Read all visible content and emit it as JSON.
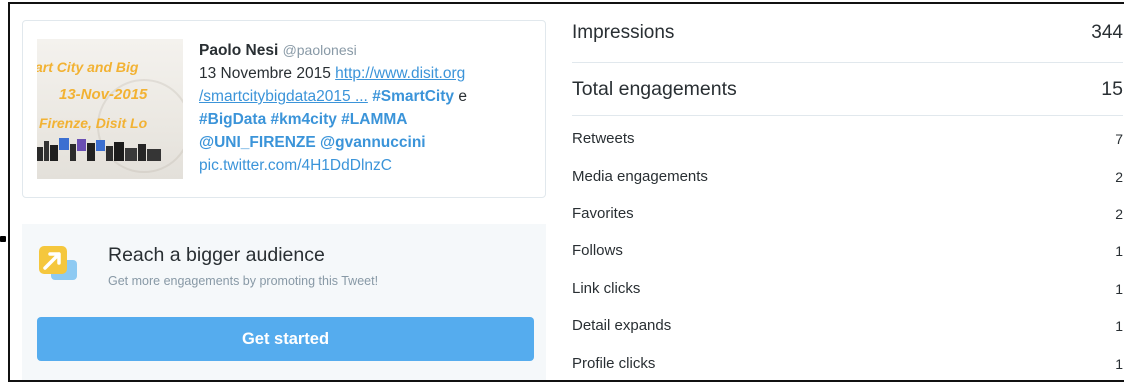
{
  "tweet": {
    "author_name": "Paolo Nesi",
    "author_handle": "@paolonesi",
    "date_text": "13 Novembre 2015",
    "link_line1": "http://www.disit.org",
    "link_line2": "/smartcitybigdata2015 ...",
    "hashtag_smartcity": "#SmartCity",
    "conj_e": " e",
    "hashtag_bigdata": "#BigData",
    "hashtag_km4city": "#km4city",
    "hashtag_lamma": "#LAMMA",
    "mention_unifirenze": "@UNI_FIRENZE",
    "mention_gvannuccini": "@gvannuccini",
    "pic_link": "pic.twitter.com/4H1DdDlnzC",
    "thumbnail": {
      "line1": "art City and Big",
      "line2": "13-Nov-2015",
      "line3": "Firenze, Disit Lo",
      "accent": "#f2b233"
    }
  },
  "promote": {
    "icon": "promote-arrow-icon",
    "title": "Reach a bigger audience",
    "subtitle": "Get more engagements by promoting this Tweet!",
    "button_label": "Get started",
    "button_color": "#55acee"
  },
  "metrics": {
    "impressions": {
      "label": "Impressions",
      "value": "344"
    },
    "total_engagements": {
      "label": "Total engagements",
      "value": "15"
    },
    "breakdown": [
      {
        "label": "Retweets",
        "value": "7"
      },
      {
        "label": "Media engagements",
        "value": "2"
      },
      {
        "label": "Favorites",
        "value": "2"
      },
      {
        "label": "Follows",
        "value": "1"
      },
      {
        "label": "Link clicks",
        "value": "1"
      },
      {
        "label": "Detail expands",
        "value": "1"
      },
      {
        "label": "Profile clicks",
        "value": "1"
      }
    ]
  }
}
